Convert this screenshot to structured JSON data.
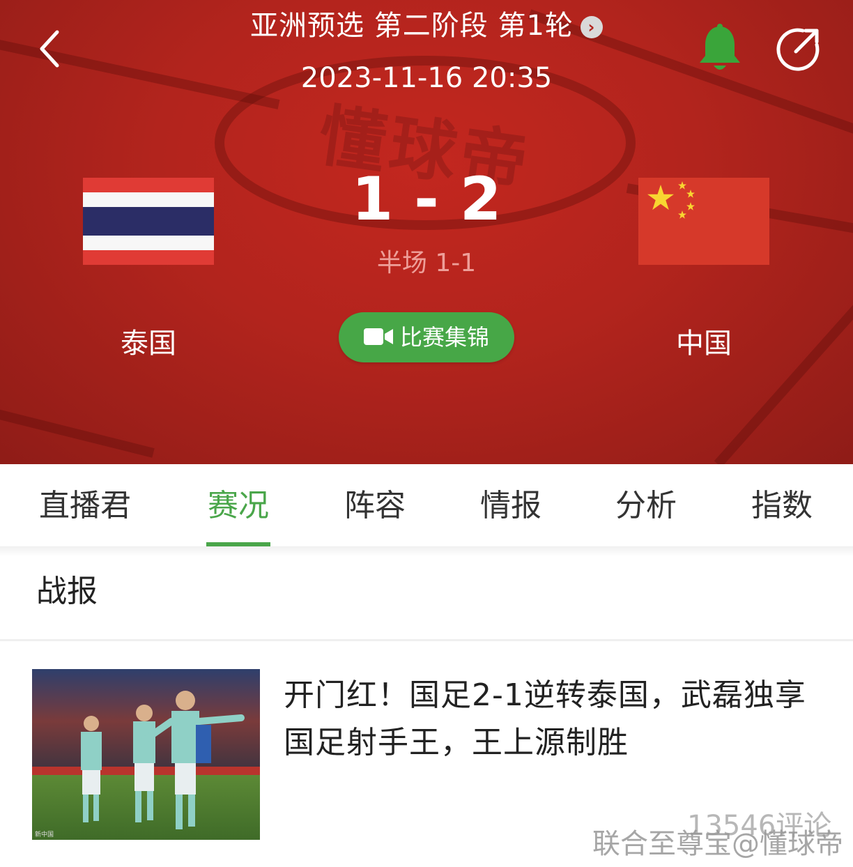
{
  "header": {
    "title": "亚洲预选 第二阶段 第1轮",
    "datetime": "2023-11-16 20:35",
    "watermark_logo": "懂球帝",
    "accent_bell_color": "#3aa53a"
  },
  "match": {
    "home_team": "泰国",
    "away_team": "中国",
    "score": "1 - 2",
    "halftime": "半场 1-1",
    "highlights_label": "比赛集锦"
  },
  "tabs": [
    {
      "label": "直播君",
      "active": false
    },
    {
      "label": "赛况",
      "active": true
    },
    {
      "label": "阵容",
      "active": false
    },
    {
      "label": "情报",
      "active": false
    },
    {
      "label": "分析",
      "active": false
    },
    {
      "label": "指数",
      "active": false
    }
  ],
  "report": {
    "section_title": "战报",
    "headline": "开门红！国足2-1逆转泰国，武磊独享国足射手王，王上源制胜",
    "comments": "13546评论",
    "thumb_caption": "新中国"
  },
  "watermark": "联合至尊宝@懂球帝",
  "colors": {
    "header_red": "#b2241d",
    "accent_green": "#4aa64a",
    "highlight_button": "#47a747"
  }
}
